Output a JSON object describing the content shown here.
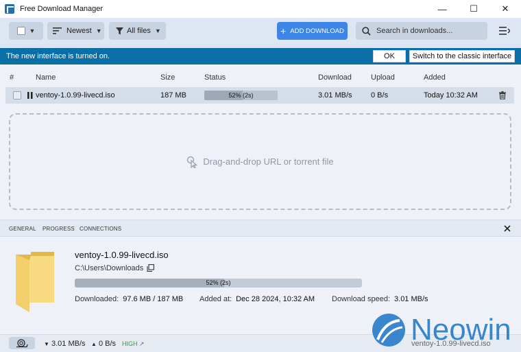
{
  "window": {
    "title": "Free Download Manager",
    "minimize": "—",
    "maximize": "☐",
    "close": "✕"
  },
  "toolbar": {
    "sort_label": "Newest",
    "filter_label": "All files",
    "add_download_label": "ADD DOWNLOAD",
    "search_placeholder": "Search in downloads..."
  },
  "banner": {
    "message": "The new interface is turned on.",
    "ok_label": "OK",
    "switch_label": "Switch to the classic interface"
  },
  "list": {
    "columns": [
      "#",
      "Name",
      "Size",
      "Status",
      "Download",
      "Upload",
      "Added"
    ],
    "rows": [
      {
        "name": "ventoy-1.0.99-livecd.iso",
        "size": "187 MB",
        "progress": 0.52,
        "status": "52% (2s)",
        "download": "3.01 MB/s",
        "upload": "0 B/s",
        "added": "Today 10:32 AM"
      }
    ]
  },
  "dropzone": {
    "text": "Drag-and-drop URL or torrent file"
  },
  "details": {
    "tabs": [
      "GENERAL",
      "PROGRESS",
      "CONNECTIONS"
    ],
    "name": "ventoy-1.0.99-livecd.iso",
    "path": "C:\\Users\\Downloads",
    "progress": 0.52,
    "progress_text": "52% (2s)",
    "downloaded_label": "Downloaded:",
    "downloaded_value": "97.6 MB / 187 MB",
    "added_label": "Added at:",
    "added_value": "Dec 28 2024, 10:32 AM",
    "speed_label": "Download speed:",
    "speed_value": "3.01 MB/s"
  },
  "statusbar": {
    "down_speed": "3.01 MB/s",
    "up_speed": "0 B/s",
    "priority": "HIGH",
    "current_file": "ventoy-1.0.99-livecd.iso"
  },
  "watermark": {
    "text": "Neowin"
  },
  "colors": {
    "accent": "#3d86e6",
    "banner": "#0a6fa7",
    "folder": "#f3cf6b"
  }
}
